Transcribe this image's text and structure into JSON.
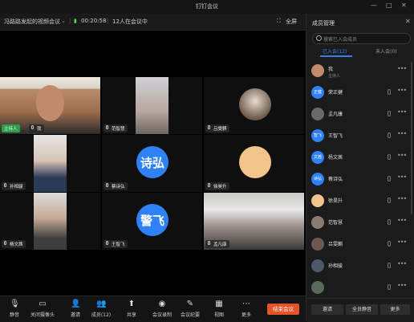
{
  "window": {
    "title": "钉钉会议"
  },
  "toolbar": {
    "meeting_name": "冯路路发起的视频会议",
    "timer": "00:20:58",
    "count": "12人在会议中",
    "layout": "全屏"
  },
  "tiles": [
    {
      "name": "主持人",
      "name2": "我"
    },
    {
      "name": "范智慧"
    },
    {
      "name": "吕雯麒"
    },
    {
      "name": "孙相骏"
    },
    {
      "name": "蔡诗弘",
      "avatar": "诗弘",
      "color": "#2f82f6"
    },
    {
      "name": "徐昊升"
    },
    {
      "name": "杨文茜"
    },
    {
      "name": "王智飞",
      "avatar": "警飞",
      "color": "#2f82f6"
    },
    {
      "name": "孟凡康"
    }
  ],
  "bottom": {
    "mute": "静音",
    "camera": "关闭摄像头",
    "invite": "邀请",
    "members": "成员(12)",
    "share": "共享",
    "record": "会议录制",
    "minutes": "会议纪要",
    "view": "视图",
    "more": "更多",
    "end": "结束会议"
  },
  "panel": {
    "title": "成员管理",
    "search_placeholder": "搜索已入会成员",
    "tab_joined": "已入会(12)",
    "tab_not_joined": "未入会(0)",
    "members": [
      {
        "name": "我",
        "sub": "主持人",
        "avatar": ""
      },
      {
        "name": "荣正健",
        "avatar": "正健"
      },
      {
        "name": "孟凡康",
        "avatar": ""
      },
      {
        "name": "王智飞",
        "avatar": "智飞"
      },
      {
        "name": "杨文茜",
        "avatar": "文茜"
      },
      {
        "name": "蔡诗弘",
        "avatar": "诗弘"
      },
      {
        "name": "徐昊升",
        "avatar": ""
      },
      {
        "name": "范智慧",
        "avatar": ""
      },
      {
        "name": "吕雯麒",
        "avatar": ""
      },
      {
        "name": "孙相骏",
        "avatar": ""
      },
      {
        "name": "",
        "avatar": ""
      }
    ],
    "btn_invite": "邀请",
    "btn_mute_all": "全员静音",
    "btn_more": "更多"
  },
  "colors": {
    "accent": "#3b7cf5",
    "end": "#e5532b"
  }
}
